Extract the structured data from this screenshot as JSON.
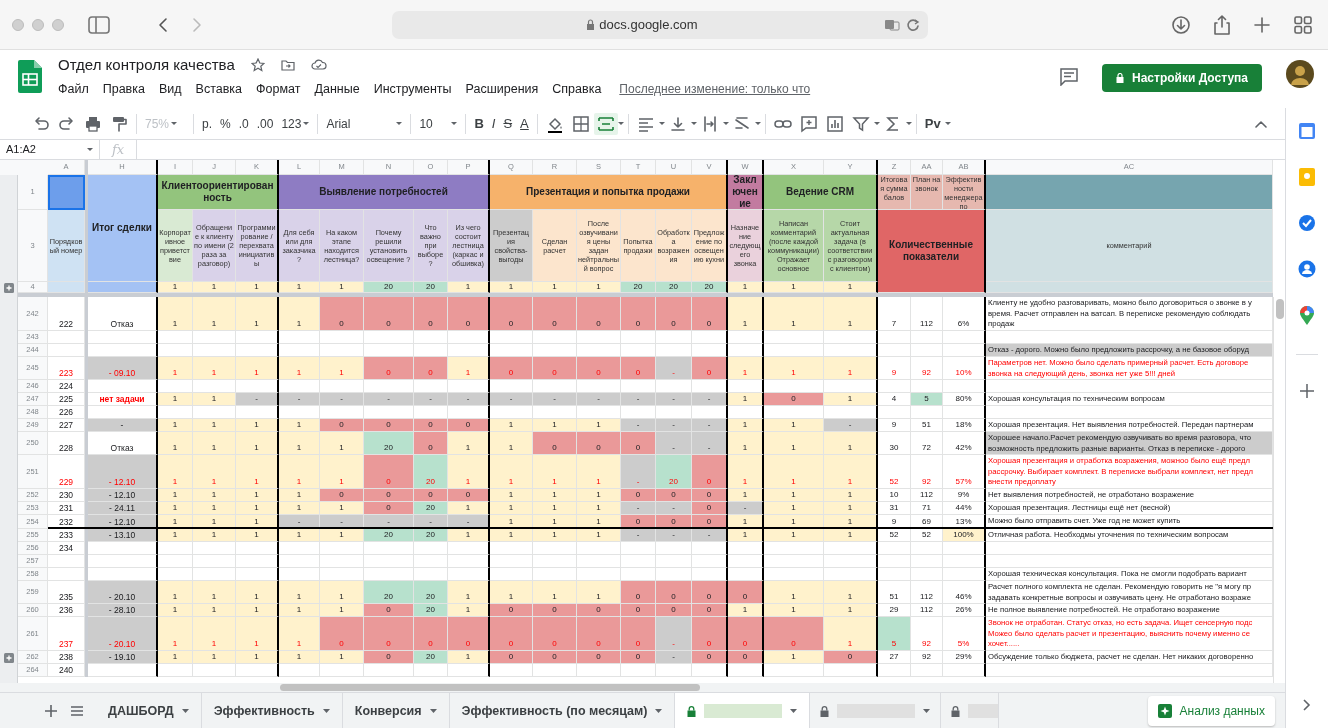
{
  "browser": {
    "url": "docs.google.com"
  },
  "document": {
    "title": "Отдел контроля качества",
    "menu": [
      "Файл",
      "Правка",
      "Вид",
      "Вставка",
      "Формат",
      "Данные",
      "Инструменты",
      "Расширения",
      "Справка"
    ],
    "last_edit": "Последнее изменение: только что",
    "share_button": "Настройки Доступа"
  },
  "toolbar": {
    "zoom": {
      "text": "75%",
      "disabled": true
    },
    "currency": "р.",
    "percent": "%",
    "decimals_less": ".0",
    "decimals_more": ".00",
    "number_format": "123",
    "font": "Arial",
    "font_size": "10",
    "bold": "B",
    "italic": "I",
    "strike": "S",
    "text_color": "A",
    "merge_active": true,
    "addon": "Pv"
  },
  "formula_bar": {
    "name_box": "A1:A2",
    "fx": "fx"
  },
  "sheet": {
    "column_letters": [
      "A",
      "H",
      "I",
      "J",
      "K",
      "L",
      "M",
      "N",
      "O",
      "P",
      "Q",
      "R",
      "S",
      "T",
      "U",
      "V",
      "W",
      "X",
      "Y",
      "Z",
      "AA",
      "AB",
      "AC"
    ],
    "header_rows": [
      "1",
      "3",
      "4"
    ],
    "number_header": {
      "label": "Порядковый номер",
      "top_selected": true
    },
    "result_header": {
      "label": "Итог сделки"
    },
    "groups": [
      {
        "label": "Клиентоориентированность",
        "color": "#93c47d",
        "criteria": [
          {
            "label": "Корпоративное приветствие",
            "color": "#d9ead3",
            "weight": {
              "text": "1",
              "color": "#fff2cc"
            }
          },
          {
            "label": "Обращение к клиенту по имени (2 раза за разговор)",
            "color": "#d9d2e9",
            "weight": {
              "text": "1",
              "color": "#fff2cc"
            }
          },
          {
            "label": "Программирование / перехвата инициативы",
            "color": "#d9d2e9",
            "weight": {
              "text": "1",
              "color": "#fff2cc"
            }
          }
        ]
      },
      {
        "label": "Выявление потребностей",
        "color": "#8e7cc3",
        "criteria": [
          {
            "label": "Для себя или для заказчика ?",
            "color": "#d9d2e9",
            "weight": {
              "text": "1",
              "color": "#fff2cc"
            }
          },
          {
            "label": "На каком этапе находится лестница?",
            "color": "#d9d2e9",
            "weight": {
              "text": "1",
              "color": "#fff2cc"
            }
          },
          {
            "label": "Почему решили установить освещение ?",
            "color": "#d9d2e9",
            "weight": {
              "text": "20",
              "color": "#b7e1cd"
            }
          },
          {
            "label": "Что важно при выборе ?",
            "color": "#d9d2e9",
            "weight": {
              "text": "20",
              "color": "#b7e1cd"
            }
          },
          {
            "label": "Из чего состоит лестница (каркас и обшивка)",
            "color": "#d9d2e9",
            "weight": {
              "text": "1",
              "color": "#fff2cc"
            }
          }
        ]
      },
      {
        "label": "Презентация и попытка продажи",
        "color": "#f6b26b",
        "criteria": [
          {
            "label": "Презентация свойства-выгоды",
            "color": "#cccccc",
            "weight": {
              "text": "1",
              "color": "#fff2cc"
            }
          },
          {
            "label": "Сделан расчет",
            "color": "#fce5cd",
            "weight": {
              "text": "1",
              "color": "#fff2cc"
            }
          },
          {
            "label": "После озвучивания цены задан нейтральный вопрос",
            "color": "#fce5cd",
            "weight": {
              "text": "1",
              "color": "#fff2cc"
            }
          },
          {
            "label": "Попытка продажи",
            "color": "#fce5cd",
            "weight": {
              "text": "20",
              "color": "#b7e1cd"
            }
          },
          {
            "label": "Обработка возражения",
            "color": "#fce5cd",
            "weight": {
              "text": "20",
              "color": "#b7e1cd"
            }
          },
          {
            "label": "Предложение по освещению кухни",
            "color": "#fce5cd",
            "weight": {
              "text": "20",
              "color": "#b7e1cd"
            }
          }
        ]
      },
      {
        "label": "Заключение",
        "color": "#c27ba0",
        "criteria": [
          {
            "label": "Назначение следующего звонка",
            "color": "#ead1dc",
            "weight": {
              "text": "1",
              "color": "#fff2cc"
            }
          }
        ]
      },
      {
        "label": "Ведение CRM",
        "color": "#93c47d",
        "criteria": [
          {
            "label": "Написан комментарий (после каждой коммуникации) Отражает основное",
            "color": "#b6d7a8",
            "weight": {
              "text": "1",
              "color": "#fff2cc"
            }
          },
          {
            "label": "Стоит актуальная задача (в соответствии с разговором с клиентом)",
            "color": "#b6d7a8",
            "weight": {
              "text": "1",
              "color": "#fff2cc"
            }
          }
        ]
      }
    ],
    "totals_headers": [
      "Итоговая сумма балов",
      "План на звонок",
      "Эффективности менеджера по"
    ],
    "totals_label": "Количественные показатели",
    "comment_header": "комментарий",
    "rows": [
      {
        "number": "242",
        "id": "222",
        "result": {
          "text": "Отказ"
        },
        "cells": [
          {
            "text": "1",
            "color": "#fff2cc"
          },
          {
            "text": "1",
            "color": "#fff2cc"
          },
          {
            "text": "1",
            "color": "#fff2cc"
          },
          {
            "text": "1",
            "color": "#fff2cc"
          },
          {
            "text": "0",
            "color": "#ea9999"
          },
          {
            "text": "0",
            "color": "#ea9999"
          },
          {
            "text": "0",
            "color": "#ea9999"
          },
          {
            "text": "0",
            "color": "#ea9999"
          },
          {
            "text": "0",
            "color": "#ea9999"
          },
          {
            "text": "0",
            "color": "#ea9999"
          },
          {
            "text": "0",
            "color": "#ea9999"
          },
          {
            "text": "0",
            "color": "#ea9999"
          },
          {
            "text": "0",
            "color": "#ea9999"
          },
          {
            "text": "0",
            "color": "#ea9999"
          },
          {
            "text": "1",
            "color": "#fff2cc"
          },
          {
            "text": "1",
            "color": "#fff2cc"
          },
          {
            "text": "1",
            "color": "#fff2cc"
          },
          {
            "text": "7"
          },
          {
            "text": "112"
          },
          {
            "text": "6%"
          }
        ],
        "comment": {
          "lines": [
            "Клиенту не удобно разговаривать, можно было договориться о звонке в у",
            "время. Расчет отправлен на ватсап. В переписке рекомендую соблюдать",
            "продаж"
          ]
        }
      },
      {
        "number": "243"
      },
      {
        "number": "244",
        "comment": {
          "lines": [
            "Отказ - дорого. Можно было предложить рассрочку, а не базовое оборуд"
          ],
          "color": "#cccccc"
        }
      },
      {
        "number": "245",
        "id": "223",
        "flagged": true,
        "result": {
          "text": "- 09.10",
          "color": "#cccccc"
        },
        "cells": [
          {
            "text": "1",
            "color": "#fff2cc"
          },
          {
            "text": "1",
            "color": "#fff2cc"
          },
          {
            "text": "1",
            "color": "#fff2cc"
          },
          {
            "text": "1",
            "color": "#fff2cc"
          },
          {
            "text": "1",
            "color": "#fff2cc"
          },
          {
            "text": "0",
            "color": "#ea9999"
          },
          {
            "text": "0",
            "color": "#ea9999"
          },
          {
            "text": "1",
            "color": "#fff2cc"
          },
          {
            "text": "0",
            "color": "#ea9999"
          },
          {
            "text": "0",
            "color": "#ea9999"
          },
          {
            "text": "0",
            "color": "#ea9999"
          },
          {
            "text": "0",
            "color": "#ea9999"
          },
          {
            "text": "-",
            "color": "#cccccc"
          },
          {
            "text": "0",
            "color": "#ea9999"
          },
          {
            "text": "1",
            "color": "#fff2cc"
          },
          {
            "text": "1",
            "color": "#fff2cc"
          },
          {
            "text": "1",
            "color": "#fff2cc"
          },
          {
            "text": "9"
          },
          {
            "text": "92"
          },
          {
            "text": "10%"
          }
        ],
        "comment": {
          "lines": [
            "Параметров нет. Можно было сделать примерный расчет. Есть договоре",
            "звонка на следующий день, звонка нет уже 5!!! дней"
          ]
        }
      },
      {
        "number": "246",
        "id": "224"
      },
      {
        "number": "247",
        "id": "225",
        "result": {
          "text": "нет задачи",
          "alert": true
        },
        "cells": [
          {
            "text": "1",
            "color": "#fff2cc"
          },
          {
            "text": "1",
            "color": "#fff2cc"
          },
          {
            "text": "-",
            "color": "#cccccc"
          },
          {
            "text": "-",
            "color": "#cccccc"
          },
          {
            "text": "-",
            "color": "#cccccc"
          },
          {
            "text": "-",
            "color": "#cccccc"
          },
          {
            "text": "-",
            "color": "#cccccc"
          },
          {
            "text": "-",
            "color": "#cccccc"
          },
          {
            "text": "-",
            "color": "#cccccc"
          },
          {
            "text": "-",
            "color": "#cccccc"
          },
          {
            "text": "-",
            "color": "#cccccc"
          },
          {
            "text": "-",
            "color": "#cccccc"
          },
          {
            "text": "-",
            "color": "#cccccc"
          },
          {
            "text": "-",
            "color": "#cccccc"
          },
          {
            "text": "1",
            "color": "#fff2cc"
          },
          {
            "text": "0",
            "color": "#ea9999"
          },
          {
            "text": "1",
            "color": "#fff2cc"
          },
          {
            "text": "4"
          },
          {
            "text": "5",
            "color": "#b7e1cd"
          },
          {
            "text": "80%"
          }
        ],
        "comment": {
          "lines": [
            "Хорошая консультация по техническим вопросам"
          ]
        }
      },
      {
        "number": "248",
        "id": "226"
      },
      {
        "number": "249",
        "id": "227",
        "result": {
          "text": "-",
          "color": "#cccccc"
        },
        "cells": [
          {
            "text": "1",
            "color": "#fff2cc"
          },
          {
            "text": "1",
            "color": "#fff2cc"
          },
          {
            "text": "1",
            "color": "#fff2cc"
          },
          {
            "text": "1",
            "color": "#fff2cc"
          },
          {
            "text": "0",
            "color": "#ea9999"
          },
          {
            "text": "0",
            "color": "#ea9999"
          },
          {
            "text": "0",
            "color": "#ea9999"
          },
          {
            "text": "0",
            "color": "#ea9999"
          },
          {
            "text": "1",
            "color": "#fff2cc"
          },
          {
            "text": "1",
            "color": "#fff2cc"
          },
          {
            "text": "1",
            "color": "#fff2cc"
          },
          {
            "text": "-",
            "color": "#cccccc"
          },
          {
            "text": "-",
            "color": "#cccccc"
          },
          {
            "text": "-",
            "color": "#cccccc"
          },
          {
            "text": "1",
            "color": "#fff2cc"
          },
          {
            "text": "1",
            "color": "#fff2cc"
          },
          {
            "text": "-",
            "color": "#cccccc"
          },
          {
            "text": "9"
          },
          {
            "text": "51"
          },
          {
            "text": "18%"
          }
        ],
        "comment": {
          "lines": [
            "Хорошая презентация. Нет выявления потребностей. Передан партнерам"
          ]
        }
      },
      {
        "number": "250",
        "id": "228",
        "result": {
          "text": "Отказ"
        },
        "cells": [
          {
            "text": "1",
            "color": "#fff2cc"
          },
          {
            "text": "1",
            "color": "#fff2cc"
          },
          {
            "text": "1",
            "color": "#fff2cc"
          },
          {
            "text": "1",
            "color": "#fff2cc"
          },
          {
            "text": "1",
            "color": "#fff2cc"
          },
          {
            "text": "20",
            "color": "#b7e1cd"
          },
          {
            "text": "0",
            "color": "#ea9999"
          },
          {
            "text": "1",
            "color": "#fff2cc"
          },
          {
            "text": "1",
            "color": "#fff2cc"
          },
          {
            "text": "0",
            "color": "#ea9999"
          },
          {
            "text": "0",
            "color": "#ea9999"
          },
          {
            "text": "0",
            "color": "#ea9999"
          },
          {
            "text": "-",
            "color": "#cccccc"
          },
          {
            "text": "-",
            "color": "#cccccc"
          },
          {
            "text": "1",
            "color": "#fff2cc"
          },
          {
            "text": "1",
            "color": "#fff2cc"
          },
          {
            "text": "1",
            "color": "#fff2cc"
          },
          {
            "text": "30"
          },
          {
            "text": "72"
          },
          {
            "text": "42%"
          }
        ],
        "comment": {
          "lines": [
            "Хорошее начало.Расчет рекомендую озвучивать во время разговора, что",
            "возможность предложить разные варианты. Отказ в переписке - дорого"
          ],
          "color": "#cccccc"
        }
      },
      {
        "number": "251",
        "id": "229",
        "flagged": true,
        "result": {
          "text": "- 12.10",
          "color": "#cccccc"
        },
        "cells": [
          {
            "text": "1",
            "color": "#fff2cc"
          },
          {
            "text": "1",
            "color": "#fff2cc"
          },
          {
            "text": "1",
            "color": "#fff2cc"
          },
          {
            "text": "1",
            "color": "#fff2cc"
          },
          {
            "text": "1",
            "color": "#fff2cc"
          },
          {
            "text": "0",
            "color": "#ea9999"
          },
          {
            "text": "20",
            "color": "#b7e1cd"
          },
          {
            "text": "1",
            "color": "#fff2cc"
          },
          {
            "text": "1",
            "color": "#fff2cc"
          },
          {
            "text": "1",
            "color": "#fff2cc"
          },
          {
            "text": "1",
            "color": "#fff2cc"
          },
          {
            "text": "-",
            "color": "#cccccc"
          },
          {
            "text": "20",
            "color": "#b7e1cd"
          },
          {
            "text": "0",
            "color": "#ea9999"
          },
          {
            "text": "1",
            "color": "#fff2cc"
          },
          {
            "text": "1",
            "color": "#fff2cc"
          },
          {
            "text": "1",
            "color": "#fff2cc"
          },
          {
            "text": "52"
          },
          {
            "text": "92"
          },
          {
            "text": "57%"
          }
        ],
        "comment": {
          "lines": [
            "Хорошая презентация и отработка возражения, можноо было ещё предл",
            "рассрочку. Выбирает комплект. В переписке выбрали комплект, нет предл",
            "внести предоплату"
          ]
        }
      },
      {
        "number": "252",
        "id": "230",
        "result": {
          "text": "- 12.10",
          "color": "#cccccc"
        },
        "cells": [
          {
            "text": "1",
            "color": "#fff2cc"
          },
          {
            "text": "1",
            "color": "#fff2cc"
          },
          {
            "text": "1",
            "color": "#fff2cc"
          },
          {
            "text": "1",
            "color": "#fff2cc"
          },
          {
            "text": "0",
            "color": "#ea9999"
          },
          {
            "text": "0",
            "color": "#ea9999"
          },
          {
            "text": "0",
            "color": "#ea9999"
          },
          {
            "text": "0",
            "color": "#ea9999"
          },
          {
            "text": "1",
            "color": "#fff2cc"
          },
          {
            "text": "1",
            "color": "#fff2cc"
          },
          {
            "text": "1",
            "color": "#fff2cc"
          },
          {
            "text": "0",
            "color": "#ea9999"
          },
          {
            "text": "0",
            "color": "#ea9999"
          },
          {
            "text": "0",
            "color": "#ea9999"
          },
          {
            "text": "1",
            "color": "#fff2cc"
          },
          {
            "text": "1",
            "color": "#fff2cc"
          },
          {
            "text": "1",
            "color": "#fff2cc"
          },
          {
            "text": "10"
          },
          {
            "text": "112"
          },
          {
            "text": "9%"
          }
        ],
        "comment": {
          "lines": [
            "Нет выявления потребностей, не отработано возражение"
          ]
        }
      },
      {
        "number": "253",
        "id": "231",
        "result": {
          "text": "- 24.11",
          "color": "#cccccc"
        },
        "cells": [
          {
            "text": "1",
            "color": "#fff2cc"
          },
          {
            "text": "1",
            "color": "#fff2cc"
          },
          {
            "text": "1",
            "color": "#fff2cc"
          },
          {
            "text": "1",
            "color": "#fff2cc"
          },
          {
            "text": "1",
            "color": "#fff2cc"
          },
          {
            "text": "0",
            "color": "#ea9999"
          },
          {
            "text": "20",
            "color": "#b7e1cd"
          },
          {
            "text": "1",
            "color": "#fff2cc"
          },
          {
            "text": "1",
            "color": "#fff2cc"
          },
          {
            "text": "1",
            "color": "#fff2cc"
          },
          {
            "text": "1",
            "color": "#fff2cc"
          },
          {
            "text": "-",
            "color": "#cccccc"
          },
          {
            "text": "-",
            "color": "#cccccc"
          },
          {
            "text": "0",
            "color": "#ea9999"
          },
          {
            "text": "-",
            "color": "#cccccc"
          },
          {
            "text": "1",
            "color": "#fff2cc"
          },
          {
            "text": "1",
            "color": "#fff2cc"
          },
          {
            "text": "31"
          },
          {
            "text": "71"
          },
          {
            "text": "44%"
          }
        ],
        "comment": {
          "lines": [
            "Хорошая презентация. Лестницы ещё нет (весной)"
          ]
        }
      },
      {
        "number": "254",
        "id": "232",
        "result": {
          "text": "- 12.10",
          "color": "#cccccc"
        },
        "divider_after": true,
        "cells": [
          {
            "text": "1",
            "color": "#fff2cc"
          },
          {
            "text": "1",
            "color": "#fff2cc"
          },
          {
            "text": "1",
            "color": "#fff2cc"
          },
          {
            "text": "-",
            "color": "#cccccc"
          },
          {
            "text": "-",
            "color": "#cccccc"
          },
          {
            "text": "-",
            "color": "#cccccc"
          },
          {
            "text": "-",
            "color": "#cccccc"
          },
          {
            "text": "-",
            "color": "#cccccc"
          },
          {
            "text": "1",
            "color": "#fff2cc"
          },
          {
            "text": "1",
            "color": "#fff2cc"
          },
          {
            "text": "1",
            "color": "#fff2cc"
          },
          {
            "text": "0",
            "color": "#ea9999"
          },
          {
            "text": "0",
            "color": "#ea9999"
          },
          {
            "text": "0",
            "color": "#ea9999"
          },
          {
            "text": "1",
            "color": "#fff2cc"
          },
          {
            "text": "1",
            "color": "#fff2cc"
          },
          {
            "text": "1",
            "color": "#fff2cc"
          },
          {
            "text": "9"
          },
          {
            "text": "69"
          },
          {
            "text": "13%"
          }
        ],
        "comment": {
          "lines": [
            "Можно было отправить счет. Уже год не может купить"
          ]
        }
      },
      {
        "number": "255",
        "id": "233",
        "result": {
          "text": "- 13.10",
          "color": "#cccccc"
        },
        "cells": [
          {
            "text": "1",
            "color": "#fff2cc"
          },
          {
            "text": "1",
            "color": "#fff2cc"
          },
          {
            "text": "1",
            "color": "#fff2cc"
          },
          {
            "text": "1",
            "color": "#fff2cc"
          },
          {
            "text": "1",
            "color": "#fff2cc"
          },
          {
            "text": "20",
            "color": "#b7e1cd"
          },
          {
            "text": "20",
            "color": "#b7e1cd"
          },
          {
            "text": "1",
            "color": "#fff2cc"
          },
          {
            "text": "1",
            "color": "#fff2cc"
          },
          {
            "text": "1",
            "color": "#fff2cc"
          },
          {
            "text": "1",
            "color": "#fff2cc"
          },
          {
            "text": "-",
            "color": "#cccccc"
          },
          {
            "text": "-",
            "color": "#cccccc"
          },
          {
            "text": "-",
            "color": "#cccccc"
          },
          {
            "text": "1",
            "color": "#fff2cc"
          },
          {
            "text": "1",
            "color": "#fff2cc"
          },
          {
            "text": "1",
            "color": "#fff2cc"
          },
          {
            "text": "52"
          },
          {
            "text": "52"
          },
          {
            "text": "100%",
            "color": "#fff2cc"
          }
        ],
        "comment": {
          "lines": [
            "Отличная работа. Необходмы уточнения по техническим вопросам"
          ]
        }
      },
      {
        "number": "256",
        "id": "234"
      },
      {
        "number": "257"
      },
      {
        "number": "258",
        "comment": {
          "lines": [
            "Хорошая техническая консультация. Пока не смогли подобрать вариант"
          ]
        }
      },
      {
        "number": "259",
        "id": "235",
        "result": {
          "text": "- 20.10",
          "color": "#cccccc"
        },
        "cells": [
          {
            "text": "1",
            "color": "#fff2cc"
          },
          {
            "text": "1",
            "color": "#fff2cc"
          },
          {
            "text": "1",
            "color": "#fff2cc"
          },
          {
            "text": "1",
            "color": "#fff2cc"
          },
          {
            "text": "1",
            "color": "#fff2cc"
          },
          {
            "text": "20",
            "color": "#b7e1cd"
          },
          {
            "text": "20",
            "color": "#b7e1cd"
          },
          {
            "text": "1",
            "color": "#fff2cc"
          },
          {
            "text": "1",
            "color": "#fff2cc"
          },
          {
            "text": "1",
            "color": "#fff2cc"
          },
          {
            "text": "1",
            "color": "#fff2cc"
          },
          {
            "text": "0",
            "color": "#ea9999"
          },
          {
            "text": "0",
            "color": "#ea9999"
          },
          {
            "text": "0",
            "color": "#ea9999"
          },
          {
            "text": "0",
            "color": "#ea9999"
          },
          {
            "text": "1",
            "color": "#fff2cc"
          },
          {
            "text": "1",
            "color": "#fff2cc"
          },
          {
            "text": "51"
          },
          {
            "text": "112"
          },
          {
            "text": "46%"
          }
        ],
        "comment": {
          "lines": [
            "Расчет полного комплекта не сделан. Рекомендую говорить не \"я могу пр",
            "задавать конкретные вопросы и озвучивать цену. Не отработано возраже"
          ]
        }
      },
      {
        "number": "260",
        "id": "236",
        "result": {
          "text": "- 28.10",
          "color": "#cccccc"
        },
        "cells": [
          {
            "text": "1",
            "color": "#fff2cc"
          },
          {
            "text": "1",
            "color": "#fff2cc"
          },
          {
            "text": "1",
            "color": "#fff2cc"
          },
          {
            "text": "1",
            "color": "#fff2cc"
          },
          {
            "text": "1",
            "color": "#fff2cc"
          },
          {
            "text": "0",
            "color": "#ea9999"
          },
          {
            "text": "20",
            "color": "#b7e1cd"
          },
          {
            "text": "1",
            "color": "#fff2cc"
          },
          {
            "text": "0",
            "color": "#ea9999"
          },
          {
            "text": "0",
            "color": "#ea9999"
          },
          {
            "text": "0",
            "color": "#ea9999"
          },
          {
            "text": "0",
            "color": "#ea9999"
          },
          {
            "text": "0",
            "color": "#ea9999"
          },
          {
            "text": "0",
            "color": "#ea9999"
          },
          {
            "text": "1",
            "color": "#fff2cc"
          },
          {
            "text": "1",
            "color": "#fff2cc"
          },
          {
            "text": "1",
            "color": "#fff2cc"
          },
          {
            "text": "29"
          },
          {
            "text": "112"
          },
          {
            "text": "26%"
          }
        ],
        "comment": {
          "lines": [
            "Не полное выявление потребностей. Не отработано возражение"
          ]
        }
      },
      {
        "number": "261",
        "id": "237",
        "flagged": true,
        "result": {
          "text": "- 20.10",
          "color": "#cccccc"
        },
        "cells": [
          {
            "text": "1",
            "color": "#fff2cc"
          },
          {
            "text": "1",
            "color": "#fff2cc"
          },
          {
            "text": "1",
            "color": "#fff2cc"
          },
          {
            "text": "1",
            "color": "#fff2cc"
          },
          {
            "text": "0",
            "color": "#ea9999"
          },
          {
            "text": "0",
            "color": "#ea9999"
          },
          {
            "text": "0",
            "color": "#ea9999"
          },
          {
            "text": "0",
            "color": "#ea9999"
          },
          {
            "text": "0",
            "color": "#ea9999"
          },
          {
            "text": "0",
            "color": "#ea9999"
          },
          {
            "text": "0",
            "color": "#ea9999"
          },
          {
            "text": "0",
            "color": "#ea9999"
          },
          {
            "text": "-",
            "color": "#cccccc"
          },
          {
            "text": "0",
            "color": "#ea9999"
          },
          {
            "text": "0",
            "color": "#ea9999"
          },
          {
            "text": "0",
            "color": "#ea9999"
          },
          {
            "text": "1",
            "color": "#fff2cc"
          },
          {
            "text": "5",
            "color": "#b7e1cd"
          },
          {
            "text": "92"
          },
          {
            "text": "5%"
          }
        ],
        "comment": {
          "lines": [
            "Звонок не отработан. Статус отказ, но есть задача. Ищет сенсерную подс",
            "Можео было сделать расчет и презентацию, выяснить почему именно се",
            "хочет......"
          ]
        }
      },
      {
        "number": "262",
        "id": "238",
        "result": {
          "text": "- 19.10",
          "color": "#cccccc"
        },
        "cells": [
          {
            "text": "1",
            "color": "#fff2cc"
          },
          {
            "text": "1",
            "color": "#fff2cc"
          },
          {
            "text": "1",
            "color": "#fff2cc"
          },
          {
            "text": "1",
            "color": "#fff2cc"
          },
          {
            "text": "1",
            "color": "#fff2cc"
          },
          {
            "text": "0",
            "color": "#ea9999"
          },
          {
            "text": "20",
            "color": "#b7e1cd"
          },
          {
            "text": "1",
            "color": "#fff2cc"
          },
          {
            "text": "0",
            "color": "#ea9999"
          },
          {
            "text": "0",
            "color": "#ea9999"
          },
          {
            "text": "0",
            "color": "#ea9999"
          },
          {
            "text": "0",
            "color": "#ea9999"
          },
          {
            "text": "-",
            "color": "#cccccc"
          },
          {
            "text": "0",
            "color": "#ea9999"
          },
          {
            "text": "0",
            "color": "#ea9999"
          },
          {
            "text": "1",
            "color": "#fff2cc"
          },
          {
            "text": "0",
            "color": "#ea9999"
          },
          {
            "text": "27"
          },
          {
            "text": "92"
          },
          {
            "text": "29%"
          }
        ],
        "comment": {
          "lines": [
            "Обсуждение только бюджета, расчет не сделан. Нет никаких договоренно"
          ]
        }
      },
      {
        "number": "264",
        "id": "240"
      }
    ]
  },
  "tabs": [
    {
      "label": "ДАШБОРД",
      "selected": false
    },
    {
      "label": "Эффективность",
      "selected": false
    },
    {
      "label": "Конверсия",
      "selected": false
    },
    {
      "label": "Эффективность (по месяцам)",
      "selected": false
    },
    {
      "kind": "hidden",
      "locked": true,
      "selected": true
    },
    {
      "kind": "hidden",
      "locked": true,
      "selected": false
    },
    {
      "kind": "hidden",
      "locked": true,
      "selected": false
    }
  ],
  "explore_button": "Анализ данных"
}
